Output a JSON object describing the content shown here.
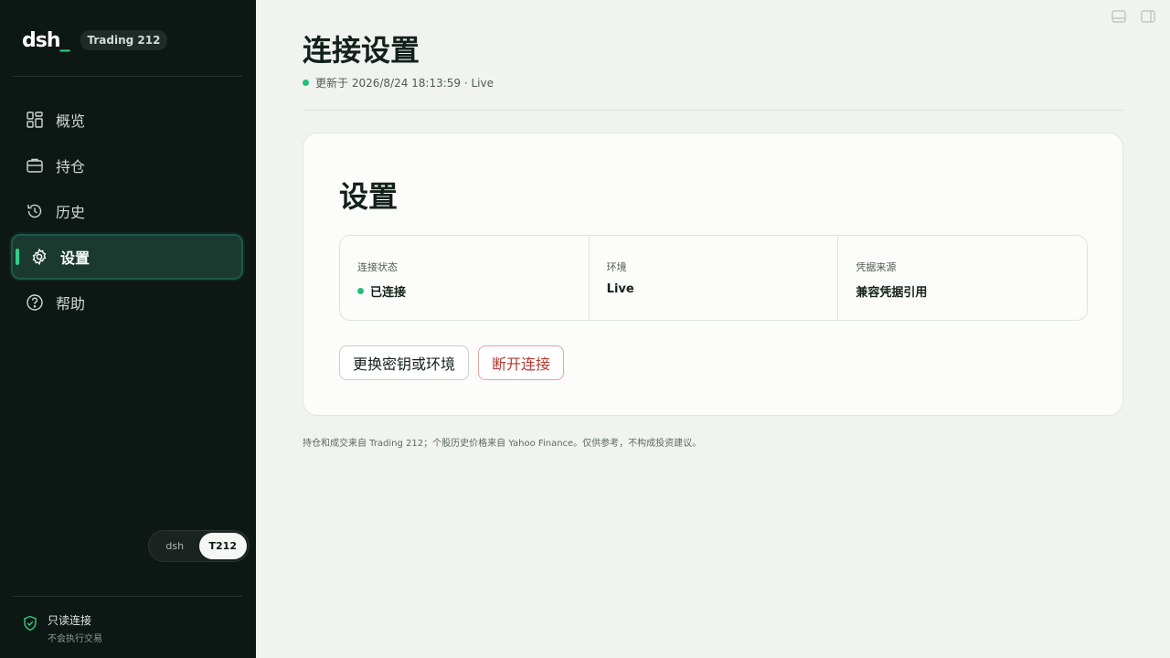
{
  "brand": {
    "logo": "dsh",
    "cursor": "_",
    "badge": "Trading 212"
  },
  "nav": [
    {
      "label": "概览",
      "icon": "dashboard-grid-icon",
      "active": false
    },
    {
      "label": "持仓",
      "icon": "briefcase-icon",
      "active": false
    },
    {
      "label": "历史",
      "icon": "history-icon",
      "active": false
    },
    {
      "label": "设置",
      "icon": "gear-icon",
      "active": true
    },
    {
      "label": "帮助",
      "icon": "help-icon",
      "active": false
    }
  ],
  "toggle": {
    "options": [
      "dsh",
      "T212"
    ],
    "selected": "T212"
  },
  "footer": {
    "title": "只读连接",
    "subtitle": "不会执行交易",
    "icon": "shield-check-icon"
  },
  "header": {
    "title": "连接设置",
    "updated": "更新于 2026/8/24 18:13:59 · Live"
  },
  "card": {
    "title": "设置",
    "info": [
      {
        "label": "连接状态",
        "value": "已连接"
      },
      {
        "label": "环境",
        "value": "Live"
      },
      {
        "label": "凭据来源",
        "value": "兼容凭据引用"
      }
    ],
    "buttons": {
      "change": "更换密钥或环境",
      "disconnect": "断开连接"
    }
  },
  "disclaimer": "持仓和成交来自 Trading 212；个股历史价格来自 Yahoo Finance。仅供参考，不构成投资建议。",
  "colors": {
    "accent": "#2fcf8a",
    "sidebar": "#0d1714",
    "danger": "#b53a32",
    "status_ok": "#1fbf7a"
  }
}
